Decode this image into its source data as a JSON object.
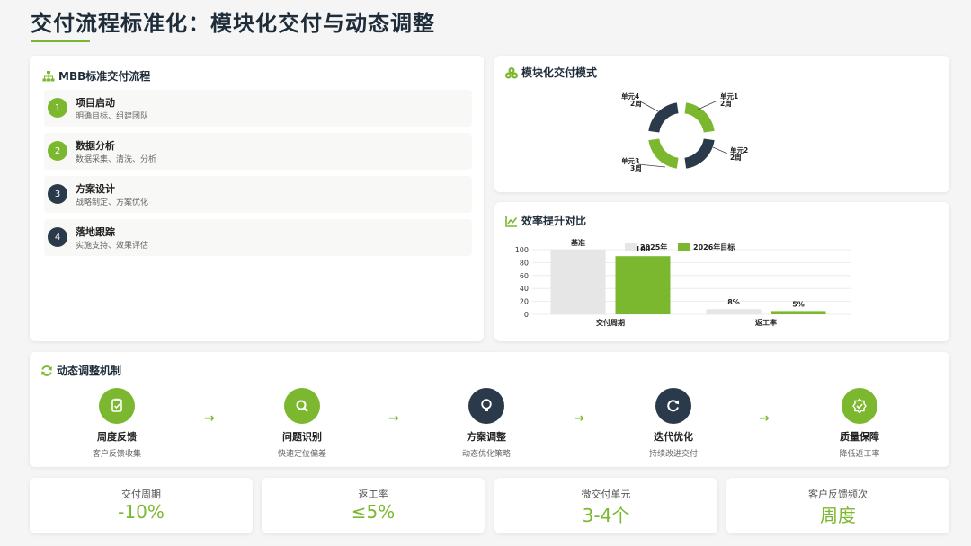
{
  "page": {
    "title": "交付流程标准化：模块化交付与动态调整"
  },
  "colors": {
    "accent": "#7cb82f",
    "navy": "#2b3a4a",
    "gray_bar": "#e6e6e6"
  },
  "flow": {
    "heading": "MBB标准交付流程",
    "icon": "org-chart-icon",
    "steps": [
      {
        "num": "1",
        "title": "项目启动",
        "desc": "明确目标、组建团队",
        "color": "#7cb82f"
      },
      {
        "num": "2",
        "title": "数据分析",
        "desc": "数据采集、清洗、分析",
        "color": "#7cb82f"
      },
      {
        "num": "3",
        "title": "方案设计",
        "desc": "战略制定、方案优化",
        "color": "#2b3a4a"
      },
      {
        "num": "4",
        "title": "落地跟踪",
        "desc": "实施支持、效果评估",
        "color": "#2b3a4a"
      }
    ]
  },
  "module": {
    "heading": "模块化交付模式",
    "icon": "cubes-icon",
    "units": [
      {
        "name": "单元1",
        "duration": "2周",
        "color": "#7cb82f"
      },
      {
        "name": "单元2",
        "duration": "2周",
        "color": "#2b3a4a"
      },
      {
        "name": "单元3",
        "duration": "3周",
        "color": "#7cb82f"
      },
      {
        "name": "单元4",
        "duration": "2周",
        "color": "#2b3a4a"
      }
    ]
  },
  "efficiency": {
    "heading": "效率提升对比",
    "icon": "line-chart-icon"
  },
  "chart_data": {
    "type": "bar",
    "title": "",
    "ylabel": "",
    "ylim": [
      0,
      100
    ],
    "yticks": [
      0,
      20,
      40,
      60,
      80,
      100
    ],
    "categories": [
      "交付周期",
      "返工率"
    ],
    "series": [
      {
        "name": "2025年",
        "color": "#e6e6e6",
        "values": [
          100,
          8
        ]
      },
      {
        "name": "2026年目标",
        "color": "#7cb82f",
        "values": [
          90,
          5
        ]
      }
    ],
    "data_labels": [
      [
        "基准",
        "100"
      ],
      [
        "8%",
        "5%"
      ]
    ],
    "legend_position": "top",
    "grid": true
  },
  "mechanism": {
    "heading": "动态调整机制",
    "icon": "refresh-icon",
    "items": [
      {
        "title": "周度反馈",
        "desc": "客户反馈收集",
        "icon": "clipboard-icon",
        "color": "#7cb82f"
      },
      {
        "title": "问题识别",
        "desc": "快速定位偏差",
        "icon": "search-icon",
        "color": "#7cb82f"
      },
      {
        "title": "方案调整",
        "desc": "动态优化策略",
        "icon": "lightbulb-icon",
        "color": "#2b3a4a"
      },
      {
        "title": "迭代优化",
        "desc": "持续改进交付",
        "icon": "refresh-icon",
        "color": "#2b3a4a"
      },
      {
        "title": "质量保障",
        "desc": "降低返工率",
        "icon": "check-badge-icon",
        "color": "#7cb82f"
      }
    ],
    "arrow_glyph": "→"
  },
  "metrics": [
    {
      "label": "交付周期",
      "value": "-10%"
    },
    {
      "label": "返工率",
      "value": "≤5%"
    },
    {
      "label": "微交付单元",
      "value": "3-4个"
    },
    {
      "label": "客户反馈频次",
      "value": "周度"
    }
  ]
}
